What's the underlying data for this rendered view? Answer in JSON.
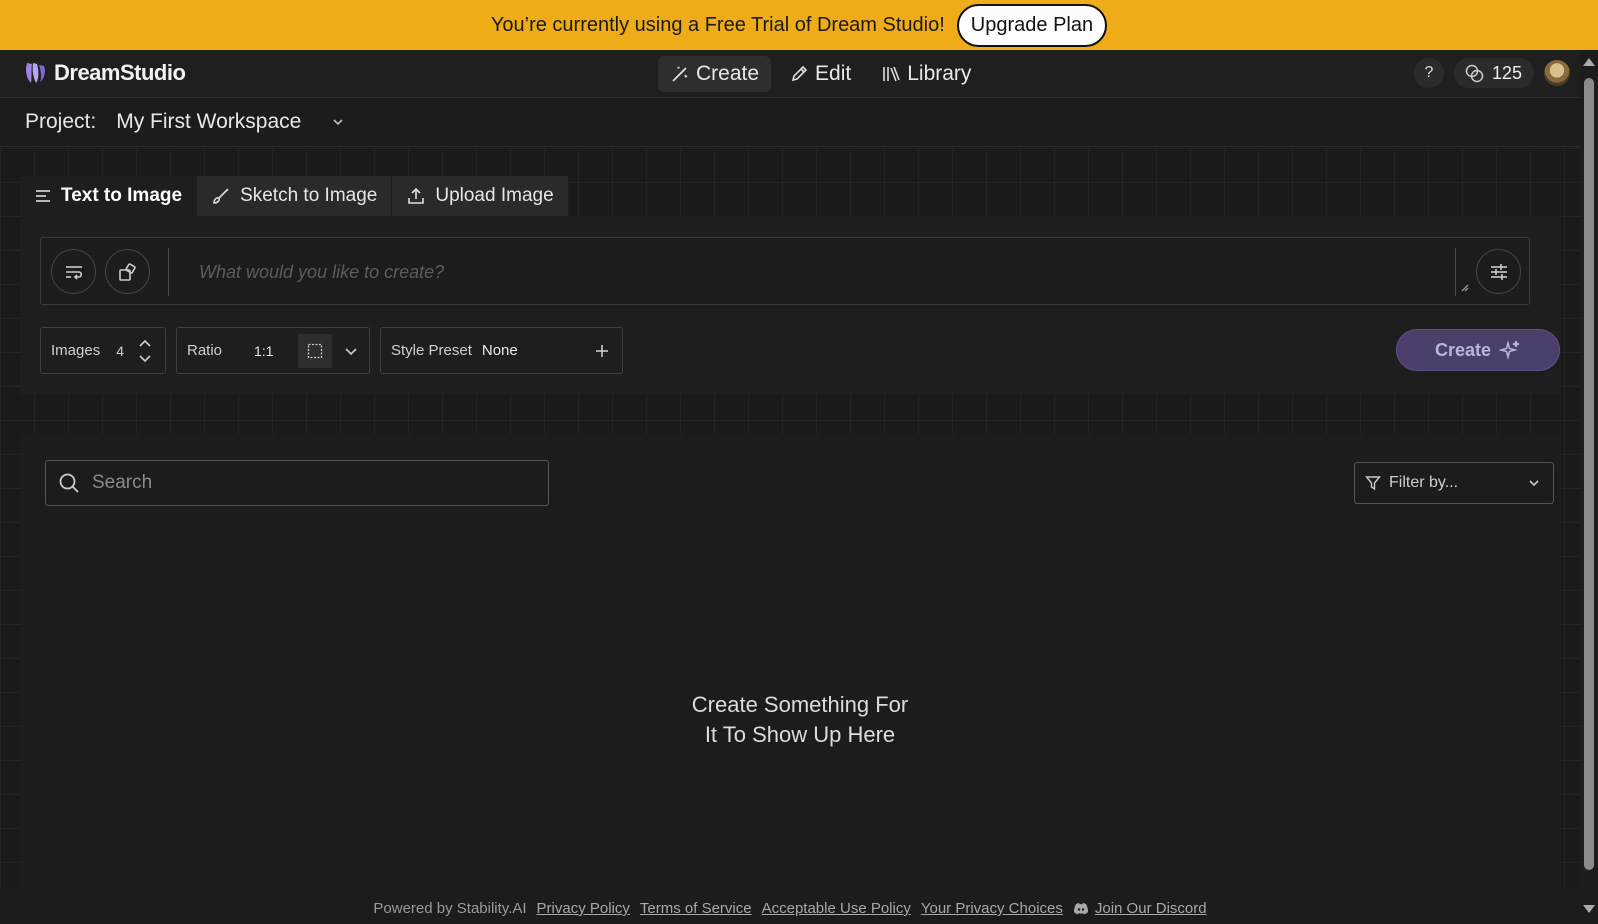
{
  "banner": {
    "message": "You’re currently using a Free Trial of Dream Studio!",
    "upgrade_label": "Upgrade Plan"
  },
  "header": {
    "app_name": "DreamStudio",
    "nav": [
      {
        "label": "Create",
        "icon": "magic-wand-icon",
        "active": true
      },
      {
        "label": "Edit",
        "icon": "pencil-icon",
        "active": false
      },
      {
        "label": "Library",
        "icon": "library-icon",
        "active": false
      }
    ],
    "help_label": "?",
    "credits": "125"
  },
  "project": {
    "label": "Project:",
    "name": "My First Workspace"
  },
  "tabs": [
    {
      "label": "Text to Image",
      "icon": "lines-icon",
      "active": true
    },
    {
      "label": "Sketch to Image",
      "icon": "brush-icon",
      "active": false
    },
    {
      "label": "Upload Image",
      "icon": "upload-icon",
      "active": false
    }
  ],
  "prompt": {
    "placeholder": "What would you like to create?"
  },
  "controls": {
    "images_label": "Images",
    "images_value": "4",
    "ratio_label": "Ratio",
    "ratio_value": "1:1",
    "style_label": "Style Preset",
    "style_value": "None",
    "create_label": "Create"
  },
  "results": {
    "search_placeholder": "Search",
    "filter_label": "Filter by...",
    "empty_line1": "Create Something For",
    "empty_line2": "It To Show Up Here"
  },
  "footer": {
    "powered_by": "Powered by Stability.AI",
    "links": [
      "Privacy Policy",
      "Terms of Service",
      "Acceptable Use Policy",
      "Your Privacy Choices",
      "Join Our Discord"
    ]
  },
  "colors": {
    "banner": "#f0ab18",
    "background": "#1c1c1c",
    "create_button": "#4a3f6b"
  }
}
